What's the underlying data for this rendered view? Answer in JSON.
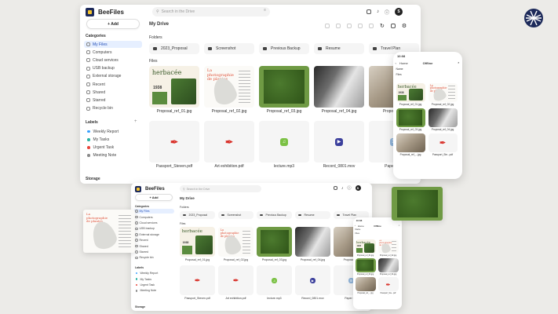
{
  "app": {
    "name": "BeeFiles"
  },
  "search": {
    "placeholder": "Search in the Drive"
  },
  "user": {
    "initial": "S"
  },
  "buttons": {
    "add": "+ Add"
  },
  "sidebar": {
    "categories_title": "Categories",
    "categories": [
      "My Files",
      "Computers",
      "Cloud services",
      "USB backup",
      "External storage",
      "Recent",
      "Shared",
      "Starred",
      "Recycle bin"
    ],
    "labels_title": "Labels",
    "labels": [
      {
        "name": "Weekly Report",
        "color": "#3aa0ff"
      },
      {
        "name": "My Tasks",
        "color": "#2bb3a3"
      },
      {
        "name": "Urgent Task",
        "color": "#e8463c"
      },
      {
        "name": "Meeting Note",
        "color": "#8a8a8a"
      }
    ],
    "storage_title": "Storage"
  },
  "main": {
    "title": "My Drive",
    "folders_title": "Folders",
    "folders": [
      "2023_Proposal",
      "Screenshot",
      "Previous Backup",
      "Resume",
      "Travel Plan"
    ],
    "files_title": "Files",
    "files": [
      "Proposal_ref_01.jpg",
      "Proposal_ref_02.jpg",
      "Proposal_ref_03.jpg",
      "Proposal_ref_04.jpg",
      "Proposal_ref",
      "Passport_Steven.pdf",
      "Art exhibition.pdf",
      "lecture.mp3",
      "Record_0801.mov",
      "Paper Sub"
    ],
    "thumb_text": {
      "herbacee": "herbacée",
      "typo": "La photographie de plantes",
      "page_num": "1938"
    }
  },
  "phone": {
    "time": "10:08",
    "back_label": "Home",
    "title": "Offline",
    "sort_label": "Name",
    "files_title": "Files",
    "files": [
      "Proposal_ref_01.jpg",
      "Proposal_ref_02.jpg",
      "Proposal_ref_03.jpg",
      "Proposal_ref_04.jpg",
      "Proposal_ref_...jpg",
      "Passport_Ste...pdf"
    ]
  },
  "icons": {
    "pdf": "pdf-icon",
    "mp3": "music-icon",
    "mov": "play-icon",
    "doc": "document-icon",
    "folder": "folder-icon"
  }
}
